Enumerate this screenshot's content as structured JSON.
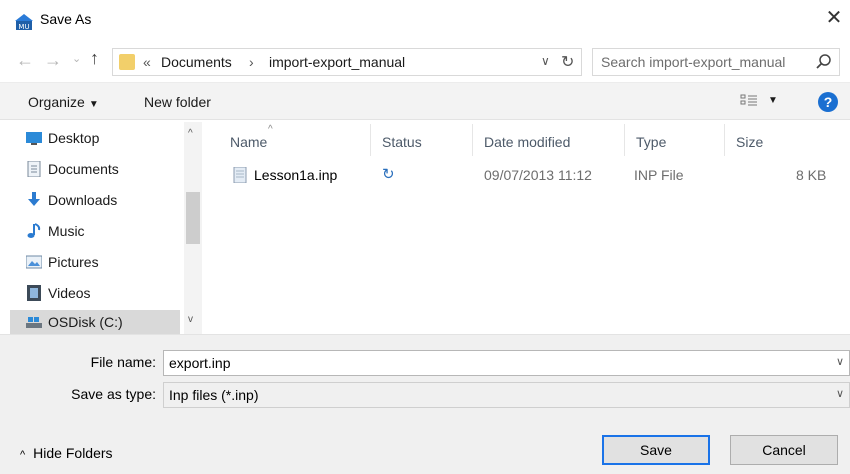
{
  "window": {
    "title": "Save As",
    "close_glyph": "✕",
    "app_icon": "app-icon",
    "accent": "#1a73e8"
  },
  "nav": {
    "back_glyph": "←",
    "forward_glyph": "→",
    "recent_glyph": "⌄",
    "up_glyph": "↑",
    "breadcrumb_more": "«",
    "breadcrumb": [
      "Documents",
      "import-export_manual"
    ],
    "separator": "›",
    "dropdown_glyph": "∨",
    "refresh_glyph": "↻",
    "search_placeholder": "Search import-export_manual"
  },
  "toolbar": {
    "organize_label": "Organize",
    "organize_caret": "▼",
    "new_folder_label": "New folder",
    "view_caret": "▼",
    "help_glyph": "?"
  },
  "sidebar": {
    "items": [
      {
        "label": "Desktop",
        "icon": "desktop-icon"
      },
      {
        "label": "Documents",
        "icon": "documents-icon"
      },
      {
        "label": "Downloads",
        "icon": "downloads-icon"
      },
      {
        "label": "Music",
        "icon": "music-icon"
      },
      {
        "label": "Pictures",
        "icon": "pictures-icon"
      },
      {
        "label": "Videos",
        "icon": "videos-icon"
      },
      {
        "label": "OSDisk (C:)",
        "icon": "drive-icon",
        "selected": true
      }
    ],
    "scroll_up_glyph": "^",
    "scroll_down_glyph": "v"
  },
  "columns": {
    "name": "Name",
    "status": "Status",
    "date": "Date modified",
    "type": "Type",
    "size": "Size",
    "sort_glyph": "^"
  },
  "files": [
    {
      "name": "Lesson1a.inp",
      "status_glyph": "↻",
      "date": "09/07/2013 11:12",
      "type": "INP File",
      "size": "8 KB"
    }
  ],
  "form": {
    "filename_label": "File name:",
    "filename_value": "export.inp",
    "savetype_label": "Save as type:",
    "savetype_value": "Inp files (*.inp)",
    "dropdown_glyph": "∨"
  },
  "footer": {
    "hide_folders_label": "Hide Folders",
    "hide_caret": "^",
    "save_label": "Save",
    "cancel_label": "Cancel"
  }
}
